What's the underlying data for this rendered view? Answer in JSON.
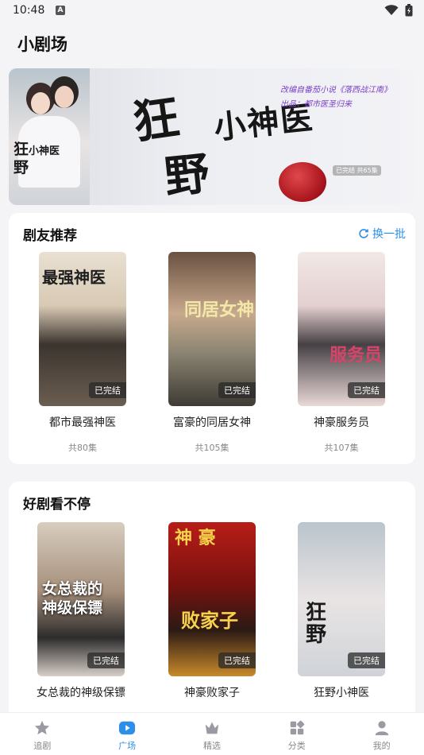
{
  "status_bar": {
    "time": "10:48",
    "indicator": "A"
  },
  "page": {
    "title": "小剧场"
  },
  "banner": {
    "poster_title_main": "狂",
    "poster_title_small": "小神医",
    "poster_title_sub": "野",
    "big_char_1": "狂",
    "big_char_2": "野",
    "small_title": "小神医",
    "tagline_1": "改编自番茄小说《落西战江南》",
    "tagline_2": "出品：都市医圣归来",
    "status": "已完结 共65集"
  },
  "recommend": {
    "title": "剧友推荐",
    "refresh_label": "换一批",
    "items": [
      {
        "name": "都市最强神医",
        "episodes": "共80集",
        "badge": "已完结",
        "poster_text": "最强神医"
      },
      {
        "name": "富豪的同居女神",
        "episodes": "共105集",
        "badge": "已完结",
        "poster_text": "同居女神"
      },
      {
        "name": "神豪服务员",
        "episodes": "共107集",
        "badge": "已完结",
        "poster_text": "服务员"
      }
    ]
  },
  "good_drama": {
    "title": "好剧看不停",
    "items": [
      {
        "name": "女总裁的神级保镖",
        "badge": "已完结",
        "poster_text_1": "女总裁的",
        "poster_text_2": "神级保镖"
      },
      {
        "name": "神豪败家子",
        "badge": "已完结",
        "poster_text_1": "神  豪",
        "poster_text_2": "败家子"
      },
      {
        "name": "狂野小神医",
        "badge": "已完结",
        "poster_text_1": "狂",
        "poster_text_2": "野"
      }
    ]
  },
  "tabbar": {
    "items": [
      {
        "label": "追剧",
        "icon": "star-icon"
      },
      {
        "label": "广场",
        "icon": "play-icon"
      },
      {
        "label": "精选",
        "icon": "crown-icon"
      },
      {
        "label": "分类",
        "icon": "grid-icon"
      },
      {
        "label": "我的",
        "icon": "person-icon"
      }
    ]
  },
  "colors": {
    "accent": "#2f8fe8",
    "background": "#f4f4f6",
    "card": "#ffffff"
  }
}
